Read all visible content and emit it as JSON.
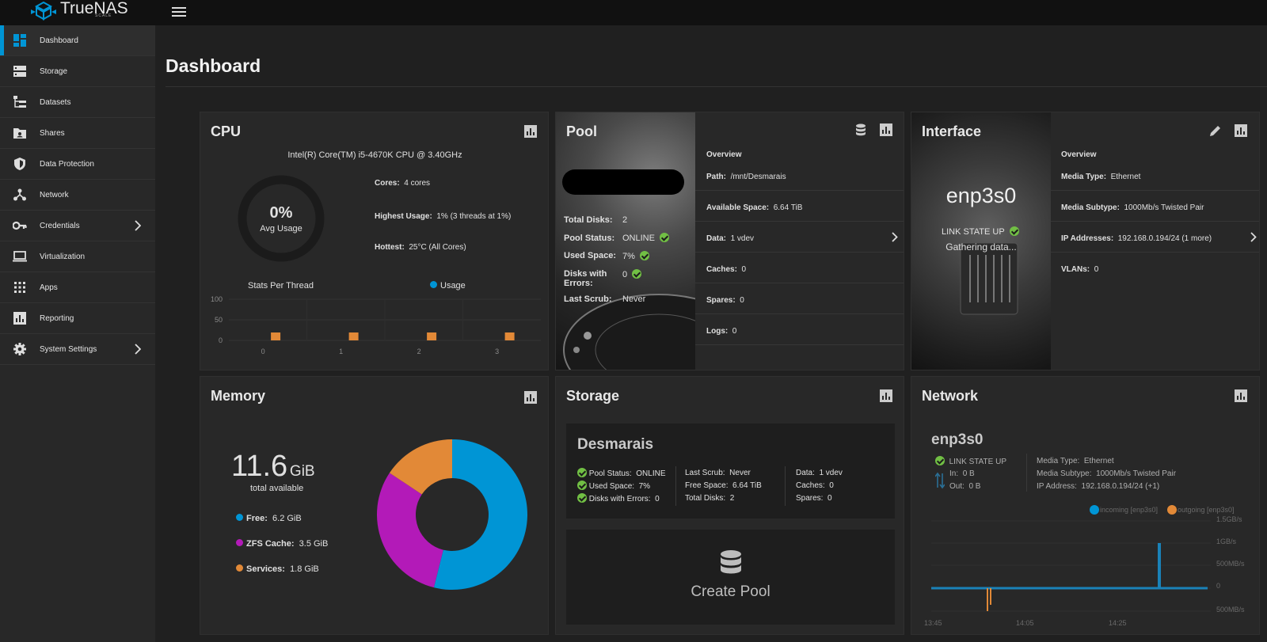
{
  "app": {
    "name": "TrueNAS",
    "edition": "SCALE"
  },
  "sidebar": {
    "items": [
      {
        "label": "Dashboard",
        "icon": "dashboard-icon"
      },
      {
        "label": "Storage",
        "icon": "storage-icon"
      },
      {
        "label": "Datasets",
        "icon": "datasets-icon"
      },
      {
        "label": "Shares",
        "icon": "shares-icon"
      },
      {
        "label": "Data Protection",
        "icon": "shield-icon"
      },
      {
        "label": "Network",
        "icon": "network-icon"
      },
      {
        "label": "Credentials",
        "icon": "key-icon"
      },
      {
        "label": "Virtualization",
        "icon": "laptop-icon"
      },
      {
        "label": "Apps",
        "icon": "apps-grid-icon"
      },
      {
        "label": "Reporting",
        "icon": "reporting-icon"
      },
      {
        "label": "System Settings",
        "icon": "gear-icon"
      }
    ]
  },
  "page": {
    "title": "Dashboard"
  },
  "cpu": {
    "title": "CPU",
    "model": "Intel(R) Core(TM) i5-4670K CPU @ 3.40GHz",
    "avg_value": "0%",
    "avg_label": "Avg Usage",
    "cores_label": "Cores:",
    "cores_value": "4 cores",
    "highest_label": "Highest Usage:",
    "highest_value": "1%  (3 threads at 1%)",
    "hottest_label": "Hottest:",
    "hottest_value": "25°C  (All Cores)",
    "stats_label": "Stats Per Thread",
    "legend_usage": "Usage"
  },
  "chart_data": {
    "type": "bar",
    "categories": [
      "0",
      "1",
      "2",
      "3"
    ],
    "values": [
      1,
      1,
      1,
      1
    ],
    "ylim": [
      0,
      100
    ],
    "yticks": [
      "100",
      "50",
      "0"
    ]
  },
  "pool": {
    "title": "Pool",
    "total_disks_label": "Total Disks:",
    "total_disks_value": "2",
    "status_label": "Pool Status:",
    "status_value": "ONLINE",
    "used_label": "Used Space:",
    "used_value": "7%",
    "errors_label": "Disks with Errors:",
    "errors_value": "0",
    "scrub_label": "Last Scrub:",
    "scrub_value": "Never",
    "overview": "Overview",
    "path_label": "Path:",
    "path_value": "/mnt/Desmarais",
    "avail_label": "Available Space:",
    "avail_value": "6.64 TiB",
    "data_label": "Data:",
    "data_value": "1 vdev",
    "caches_label": "Caches:",
    "caches_value": "0",
    "spares_label": "Spares:",
    "spares_value": "0",
    "logs_label": "Logs:",
    "logs_value": "0"
  },
  "interface": {
    "title": "Interface",
    "name": "enp3s0",
    "link_state": "LINK STATE UP",
    "gathering": "Gathering data...",
    "overview": "Overview",
    "media_type_label": "Media Type:",
    "media_type_value": "Ethernet",
    "media_subtype_label": "Media Subtype:",
    "media_subtype_value": "1000Mb/s Twisted Pair",
    "ip_label": "IP Addresses:",
    "ip_value": "192.168.0.194/24 (1 more)",
    "vlans_label": "VLANs:",
    "vlans_value": "0"
  },
  "memory": {
    "title": "Memory",
    "total_value": "11.6",
    "total_unit": "GiB",
    "total_label": "total available",
    "free_label": "Free:",
    "free_value": "6.2 GiB",
    "zfs_label": "ZFS Cache:",
    "zfs_value": "3.5 GiB",
    "services_label": "Services:",
    "services_value": "1.8 GiB",
    "free_gib": 6.2,
    "zfs_gib": 3.5,
    "services_gib": 1.8,
    "colors": {
      "free": "#0095d5",
      "zfs": "#b31ab8",
      "services": "#e28937"
    }
  },
  "storage": {
    "title": "Storage",
    "pool_name": "Desmarais",
    "status_label": "Pool Status:",
    "status_value": "ONLINE",
    "used_label": "Used Space:",
    "used_value": "7%",
    "errors_label": "Disks with Errors:",
    "errors_value": "0",
    "scrub_label": "Last Scrub:",
    "scrub_value": "Never",
    "free_label": "Free Space:",
    "free_value": "6.64 TiB",
    "total_disks_label": "Total Disks:",
    "total_disks_value": "2",
    "data_label": "Data:",
    "data_value": "1 vdev",
    "caches_label": "Caches:",
    "caches_value": "0",
    "spares_label": "Spares:",
    "spares_value": "0",
    "create_pool": "Create Pool"
  },
  "network": {
    "title": "Network",
    "iface": "enp3s0",
    "link_state": "LINK STATE UP",
    "in_label": "In:",
    "in_value": "0 B",
    "out_label": "Out:",
    "out_value": "0 B",
    "media_type_label": "Media Type:",
    "media_type_value": "Ethernet",
    "media_subtype_label": "Media Subtype:",
    "media_subtype_value": "1000Mb/s Twisted Pair",
    "ip_label": "IP Address:",
    "ip_value": "192.168.0.194/24 (+1)",
    "legend_in": "incoming [enp3s0]",
    "legend_out": "outgoing [enp3s0]",
    "y_ticks": [
      "1.5GB/s",
      "1GB/s",
      "500MB/s",
      "0",
      "500MB/s"
    ],
    "x_ticks": [
      "13:45",
      "14:05",
      "14:25"
    ],
    "colors": {
      "in": "#0095d5",
      "out": "#e28937"
    }
  }
}
